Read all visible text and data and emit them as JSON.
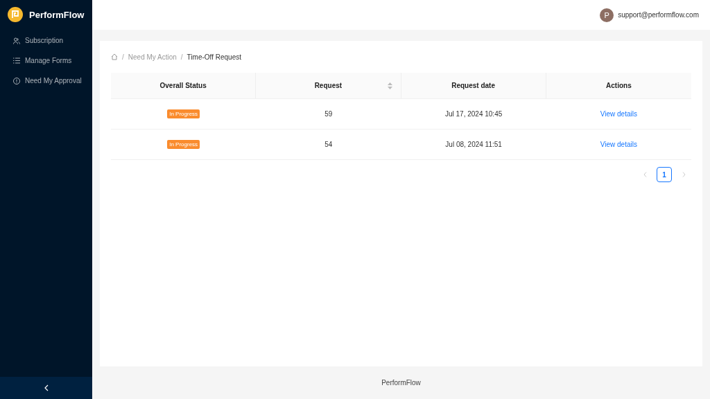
{
  "sidebar": {
    "app_name": "PerformFlow",
    "items": [
      {
        "label": "Subscription",
        "kind": "users"
      },
      {
        "label": "Manage Forms",
        "kind": "list"
      },
      {
        "label": "Need My Approval",
        "kind": "info"
      }
    ]
  },
  "header": {
    "avatar_letter": "P",
    "email": "support@performflow.com"
  },
  "breadcrumb": {
    "separator": "/",
    "items": [
      "Need My Action",
      "Time-Off Request"
    ]
  },
  "table": {
    "columns": [
      {
        "label": "Overall Status",
        "kind": "plain"
      },
      {
        "label": "Request",
        "kind": "sortable"
      },
      {
        "label": "Request date",
        "kind": "plain"
      },
      {
        "label": "Actions",
        "kind": "plain"
      }
    ],
    "rows": [
      {
        "status": "In Progress",
        "request": "59",
        "date": "Jul 17, 2024 10:45",
        "action": "View details"
      },
      {
        "status": "In Progress",
        "request": "54",
        "date": "Jul 08, 2024 11:51",
        "action": "View details"
      }
    ]
  },
  "pagination": {
    "pages": [
      {
        "label": "1",
        "selected": true
      }
    ],
    "prev_disabled": true,
    "next_disabled": true
  },
  "footer": "PerformFlow"
}
